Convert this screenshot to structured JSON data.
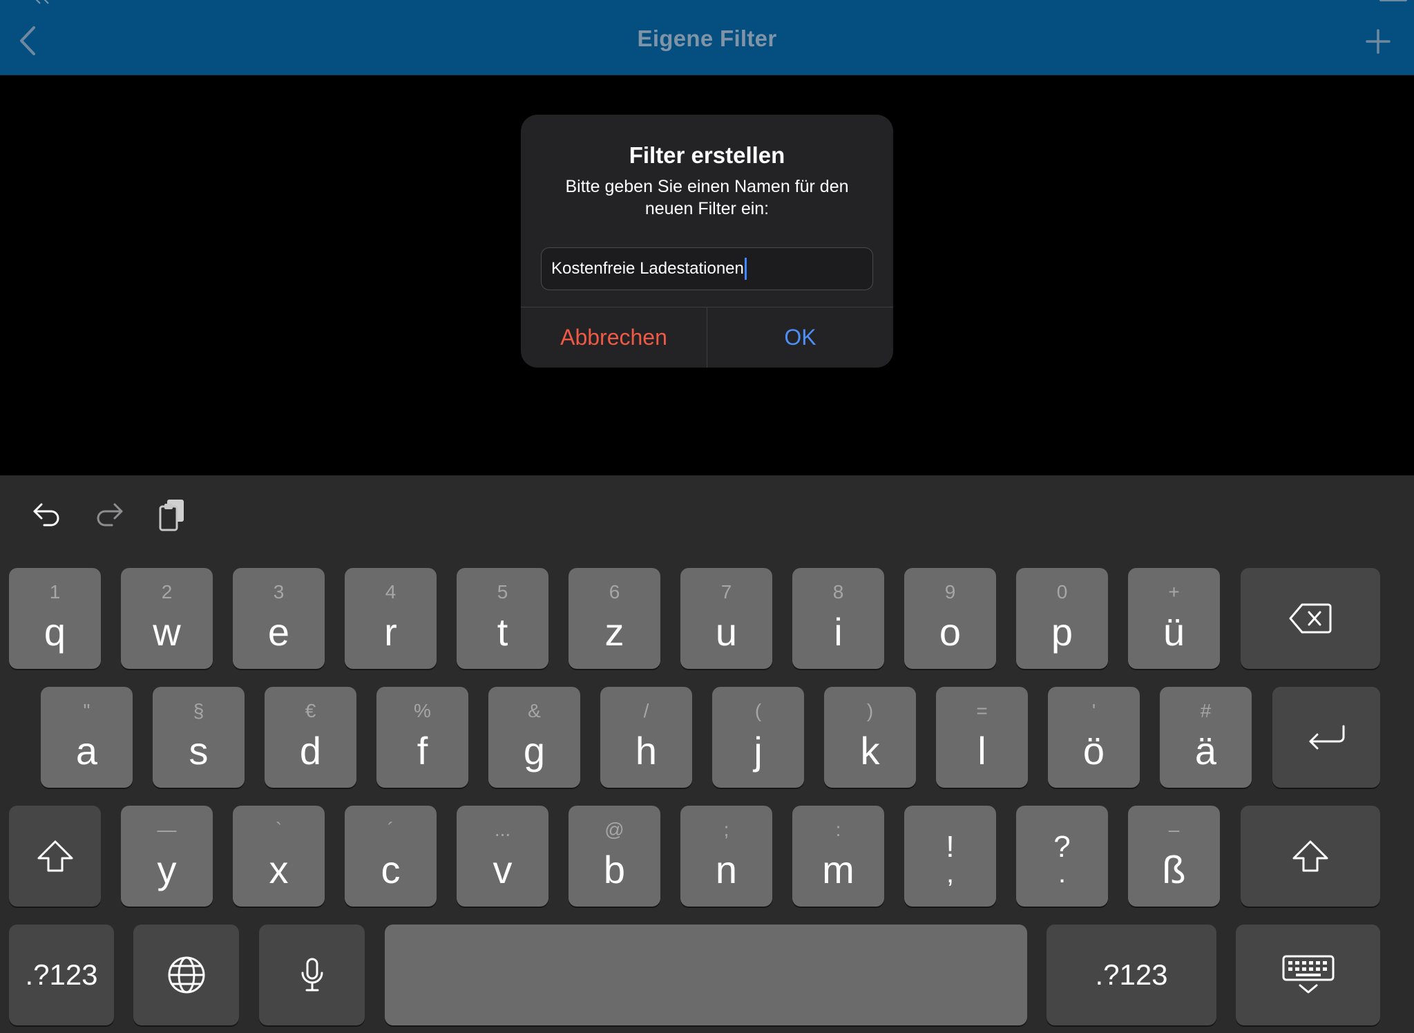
{
  "nav": {
    "title": "Eigene Filter"
  },
  "dialog": {
    "title": "Filter erstellen",
    "message": "Bitte geben Sie einen Namen für den neuen Filter ein:",
    "input_value": "Kostenfreie Ladestationen",
    "cancel": "Abbrechen",
    "ok": "OK"
  },
  "keyboard": {
    "row1": [
      {
        "hint": "1",
        "key": "q"
      },
      {
        "hint": "2",
        "key": "w"
      },
      {
        "hint": "3",
        "key": "e"
      },
      {
        "hint": "4",
        "key": "r"
      },
      {
        "hint": "5",
        "key": "t"
      },
      {
        "hint": "6",
        "key": "z"
      },
      {
        "hint": "7",
        "key": "u"
      },
      {
        "hint": "8",
        "key": "i"
      },
      {
        "hint": "9",
        "key": "o"
      },
      {
        "hint": "0",
        "key": "p"
      },
      {
        "hint": "+",
        "key": "ü"
      }
    ],
    "row2": [
      {
        "hint": "\"",
        "key": "a"
      },
      {
        "hint": "§",
        "key": "s"
      },
      {
        "hint": "€",
        "key": "d"
      },
      {
        "hint": "%",
        "key": "f"
      },
      {
        "hint": "&",
        "key": "g"
      },
      {
        "hint": "/",
        "key": "h"
      },
      {
        "hint": "(",
        "key": "j"
      },
      {
        "hint": ")",
        "key": "k"
      },
      {
        "hint": "=",
        "key": "l"
      },
      {
        "hint": "'",
        "key": "ö"
      },
      {
        "hint": "#",
        "key": "ä"
      }
    ],
    "row3": [
      {
        "hint": "—",
        "key": "y"
      },
      {
        "hint": "`",
        "key": "x"
      },
      {
        "hint": "´",
        "key": "c"
      },
      {
        "hint": "...",
        "key": "v"
      },
      {
        "hint": "@",
        "key": "b"
      },
      {
        "hint": ";",
        "key": "n"
      },
      {
        "hint": ":",
        "key": "m"
      },
      {
        "hint": "!",
        "key": ","
      },
      {
        "hint": "?",
        "key": "."
      },
      {
        "hint": "–",
        "key": "ß"
      }
    ],
    "numbers_left": ".?123",
    "numbers_right": ".?123"
  }
}
